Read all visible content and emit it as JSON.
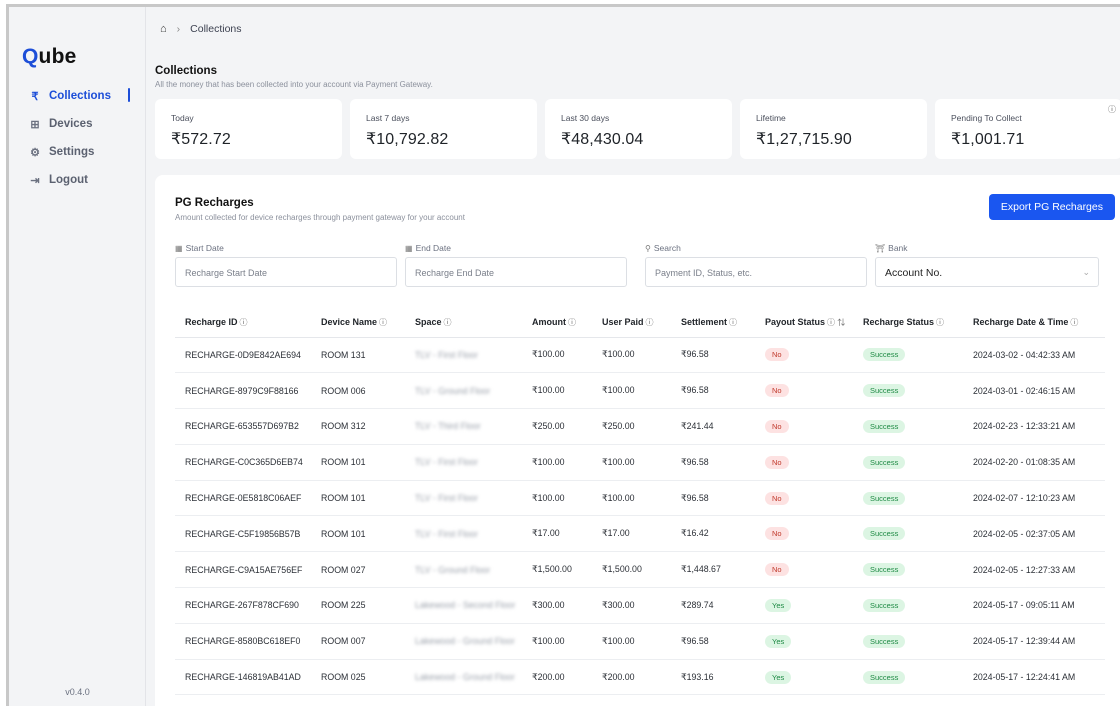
{
  "app": {
    "logo": "Qube",
    "version": "v0.4.0"
  },
  "sidebar": {
    "items": [
      {
        "label": "Collections",
        "icon": "rupee-icon",
        "glyph": "₹",
        "active": true
      },
      {
        "label": "Devices",
        "icon": "chip-icon",
        "glyph": "⊞",
        "active": false
      },
      {
        "label": "Settings",
        "icon": "gear-icon",
        "glyph": "⚙",
        "active": false
      },
      {
        "label": "Logout",
        "icon": "logout-icon",
        "glyph": "⇥",
        "active": false
      }
    ]
  },
  "breadcrumb": {
    "home_icon": "home-icon",
    "current": "Collections"
  },
  "header": {
    "title": "Collections",
    "subtitle": "All the money that has been collected into your account via Payment Gateway."
  },
  "stats": [
    {
      "label": "Today",
      "value": "₹572.72"
    },
    {
      "label": "Last 7 days",
      "value": "₹10,792.82"
    },
    {
      "label": "Last 30 days",
      "value": "₹48,430.04"
    },
    {
      "label": "Lifetime",
      "value": "₹1,27,715.90"
    },
    {
      "label": "Pending To Collect",
      "value": "₹1,001.71"
    }
  ],
  "recharges": {
    "title": "PG Recharges",
    "subtitle": "Amount collected for device recharges through payment gateway for your account",
    "export_label": "Export PG Recharges",
    "filters": {
      "start_label": "Start Date",
      "start_placeholder": "Recharge Start Date",
      "end_label": "End Date",
      "end_placeholder": "Recharge End Date",
      "search_label": "Search",
      "search_placeholder": "Payment ID, Status, etc.",
      "bank_label": "Bank",
      "bank_value": "Account No."
    },
    "columns": [
      "Recharge ID",
      "Device Name",
      "Space",
      "Amount",
      "User Paid",
      "Settlement",
      "Payout Status",
      "Recharge Status",
      "Recharge Date & Time"
    ],
    "rows": [
      {
        "id": "RECHARGE-0D9E842AE694",
        "device": "ROOM 131",
        "space": "TLV - First Floor",
        "amount": "₹100.00",
        "paid": "₹100.00",
        "settlement": "₹96.58",
        "payout": "No",
        "status": "Success",
        "date": "2024-03-02 - 04:42:33 AM"
      },
      {
        "id": "RECHARGE-8979C9F88166",
        "device": "ROOM 006",
        "space": "TLV - Ground Floor",
        "amount": "₹100.00",
        "paid": "₹100.00",
        "settlement": "₹96.58",
        "payout": "No",
        "status": "Success",
        "date": "2024-03-01 - 02:46:15 AM"
      },
      {
        "id": "RECHARGE-653557D697B2",
        "device": "ROOM 312",
        "space": "TLV - Third Floor",
        "amount": "₹250.00",
        "paid": "₹250.00",
        "settlement": "₹241.44",
        "payout": "No",
        "status": "Success",
        "date": "2024-02-23 - 12:33:21 AM"
      },
      {
        "id": "RECHARGE-C0C365D6EB74",
        "device": "ROOM 101",
        "space": "TLV - First Floor",
        "amount": "₹100.00",
        "paid": "₹100.00",
        "settlement": "₹96.58",
        "payout": "No",
        "status": "Success",
        "date": "2024-02-20 - 01:08:35 AM"
      },
      {
        "id": "RECHARGE-0E5818C06AEF",
        "device": "ROOM 101",
        "space": "TLV - First Floor",
        "amount": "₹100.00",
        "paid": "₹100.00",
        "settlement": "₹96.58",
        "payout": "No",
        "status": "Success",
        "date": "2024-02-07 - 12:10:23 AM"
      },
      {
        "id": "RECHARGE-C5F19856B57B",
        "device": "ROOM 101",
        "space": "TLV - First Floor",
        "amount": "₹17.00",
        "paid": "₹17.00",
        "settlement": "₹16.42",
        "payout": "No",
        "status": "Success",
        "date": "2024-02-05 - 02:37:05 AM"
      },
      {
        "id": "RECHARGE-C9A15AE756EF",
        "device": "ROOM 027",
        "space": "TLV - Ground Floor",
        "amount": "₹1,500.00",
        "paid": "₹1,500.00",
        "settlement": "₹1,448.67",
        "payout": "No",
        "status": "Success",
        "date": "2024-02-05 - 12:27:33 AM"
      },
      {
        "id": "RECHARGE-267F878CF690",
        "device": "ROOM 225",
        "space": "Lakewood - Second Floor",
        "amount": "₹300.00",
        "paid": "₹300.00",
        "settlement": "₹289.74",
        "payout": "Yes",
        "status": "Success",
        "date": "2024-05-17 - 09:05:11 AM"
      },
      {
        "id": "RECHARGE-8580BC618EF0",
        "device": "ROOM 007",
        "space": "Lakewood - Ground Floor",
        "amount": "₹100.00",
        "paid": "₹100.00",
        "settlement": "₹96.58",
        "payout": "Yes",
        "status": "Success",
        "date": "2024-05-17 - 12:39:44 AM"
      },
      {
        "id": "RECHARGE-146819AB41AD",
        "device": "ROOM 025",
        "space": "Lakewood - Ground Floor",
        "amount": "₹200.00",
        "paid": "₹200.00",
        "settlement": "₹193.16",
        "payout": "Yes",
        "status": "Success",
        "date": "2024-05-17 - 12:24:41 AM"
      }
    ]
  }
}
